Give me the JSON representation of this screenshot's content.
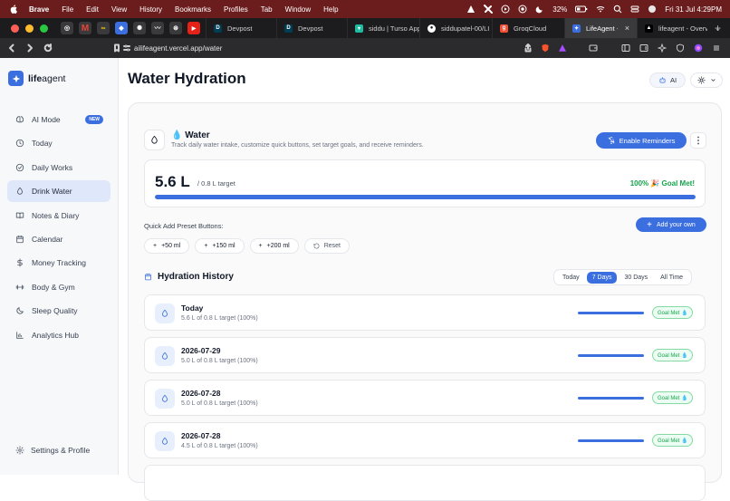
{
  "menubar": {
    "app": "Brave",
    "items": [
      "File",
      "Edit",
      "View",
      "History",
      "Bookmarks",
      "Profiles",
      "Tab",
      "Window",
      "Help"
    ],
    "battery": "32%",
    "clock": "Fri 31 Jul  4:29PM"
  },
  "tabs": [
    {
      "label": "Devpost",
      "favicon": "D",
      "color": "#003e54"
    },
    {
      "label": "Devpost",
      "favicon": "D",
      "color": "#003e54"
    },
    {
      "label": "siddu | Turso App",
      "favicon": "turso",
      "color": "#1ebca1"
    },
    {
      "label": "siddupatel-00/LI",
      "favicon": "github",
      "color": "#333333"
    },
    {
      "label": "GroqCloud",
      "favicon": "groq",
      "color": "#f55036"
    },
    {
      "label": "LifeAgent - AI",
      "favicon": "lifeagent",
      "color": "#3b6fe0",
      "active": true,
      "close": "×"
    },
    {
      "label": "lifeagent - Overv",
      "favicon": "vercel",
      "color": "#000000"
    }
  ],
  "address": {
    "url": "ailifeagent.vercel.app/water"
  },
  "brand": {
    "name_bold": "life",
    "name_rest": "agent",
    "accent": "#3b6fe0"
  },
  "nav": [
    {
      "label": "AI Mode",
      "icon": "brain-icon",
      "badge": "NEW"
    },
    {
      "label": "Today",
      "icon": "clock-icon"
    },
    {
      "label": "Daily Works",
      "icon": "check-circle-icon"
    },
    {
      "label": "Drink Water",
      "icon": "droplet-icon",
      "active": true
    },
    {
      "label": "Notes & Diary",
      "icon": "book-icon"
    },
    {
      "label": "Calendar",
      "icon": "calendar-icon"
    },
    {
      "label": "Money Tracking",
      "icon": "dollar-icon"
    },
    {
      "label": "Body & Gym",
      "icon": "dumbbell-icon"
    },
    {
      "label": "Sleep Quality",
      "icon": "moon-icon"
    },
    {
      "label": "Analytics Hub",
      "icon": "bar-chart-icon"
    }
  ],
  "settings_label": "Settings & Profile",
  "page": {
    "title": "Water Hydration",
    "ai_label": "AI"
  },
  "water": {
    "title": "💧 Water",
    "subtitle": "Track daily water intake, customize quick buttons, set target goals, and receive reminders.",
    "reminders_label": "Enable Reminders",
    "amount": "5.6 L",
    "target": "/ 0.8 L target",
    "goal_text": "100% 🎉 Goal Met!",
    "progress": 1.0
  },
  "quick": {
    "label": "Quick Add Preset Buttons:",
    "add_own": "Add your own",
    "presets": [
      "+50 ml",
      "+150 ml",
      "+200 ml"
    ],
    "reset": "Reset"
  },
  "history": {
    "title": "Hydration History",
    "ranges": [
      {
        "label": "Today"
      },
      {
        "label": "7 Days",
        "active": true
      },
      {
        "label": "30 Days"
      },
      {
        "label": "All Time"
      }
    ],
    "rows": [
      {
        "date": "Today",
        "summary": "5.6 L of 0.8 L target (100%)",
        "status": "Goal Met 💧",
        "progress": 1.0
      },
      {
        "date": "2026-07-29",
        "summary": "5.0 L of 0.8 L target (100%)",
        "status": "Goal Met 💧",
        "progress": 1.0
      },
      {
        "date": "2026-07-28",
        "summary": "5.0 L of 0.8 L target (100%)",
        "status": "Goal Met 💧",
        "progress": 1.0
      },
      {
        "date": "2026-07-28",
        "summary": "4.5 L of 0.8 L target (100%)",
        "status": "Goal Met 💧",
        "progress": 1.0
      }
    ]
  }
}
